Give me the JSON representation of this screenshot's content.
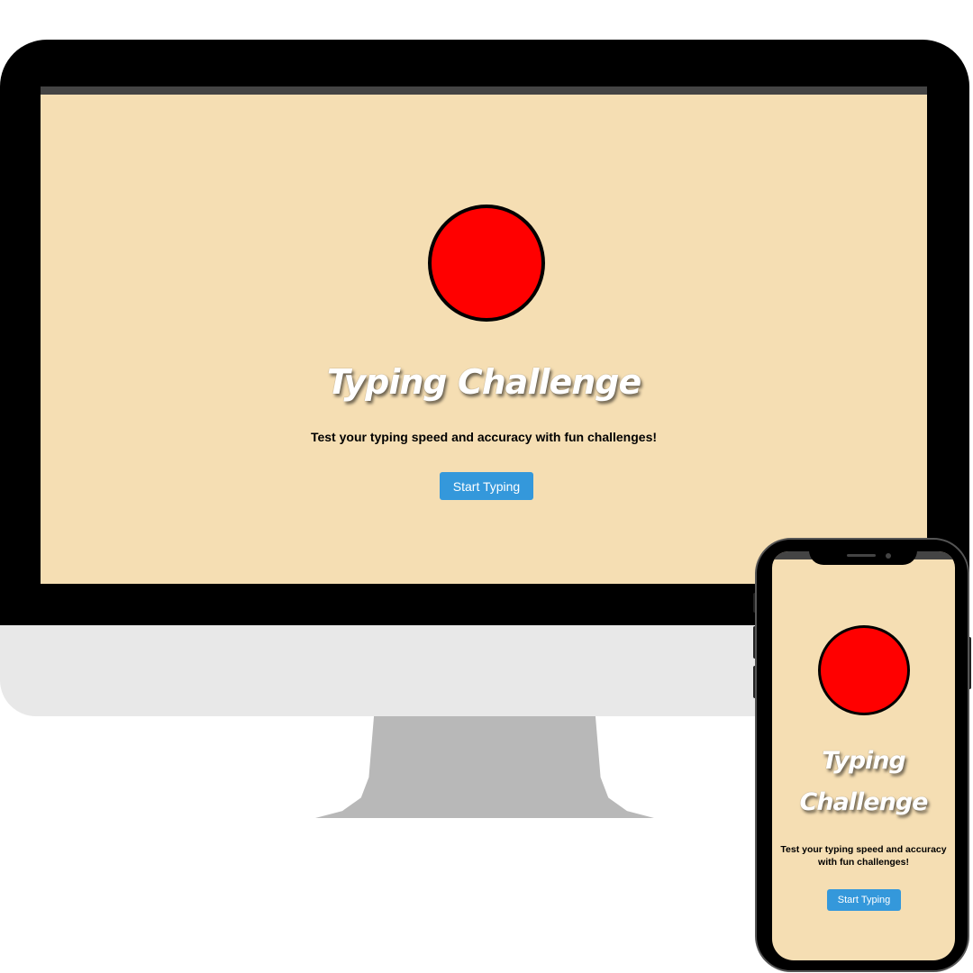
{
  "app": {
    "title": "Typing Challenge",
    "description": "Test your typing speed and accuracy with fun challenges!",
    "cta_label": "Start Typing"
  },
  "colors": {
    "screen_background": "#f5deb3",
    "circle": "#ff0000",
    "button": "#3498db",
    "title_text": "#ffffff",
    "top_strip": "#444444"
  },
  "phone": {
    "title_line1": "Typing",
    "title_line2": "Challenge"
  }
}
